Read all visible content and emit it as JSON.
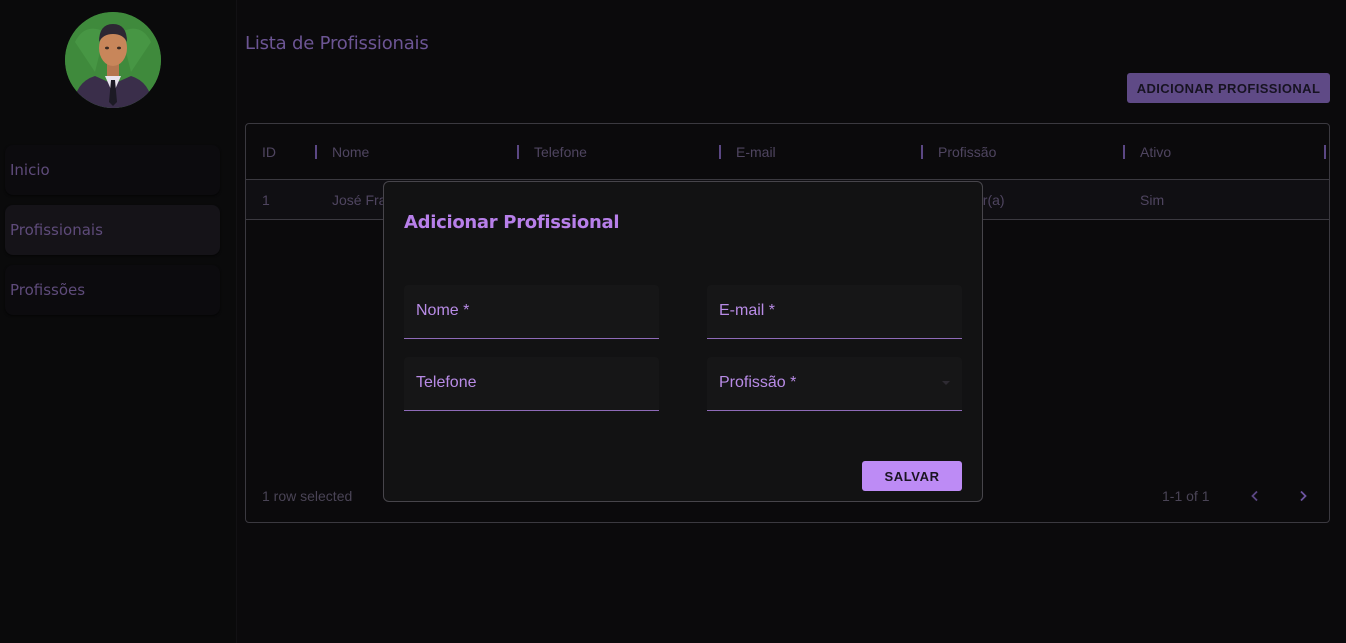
{
  "sidebar": {
    "items": [
      {
        "label": "Inicio"
      },
      {
        "label": "Profissionais"
      },
      {
        "label": "Profissões"
      }
    ]
  },
  "main": {
    "title": "Lista de Profissionais",
    "add_button": "ADICIONAR PROFISSIONAL"
  },
  "grid": {
    "columns": [
      "ID",
      "Nome",
      "Telefone",
      "E-mail",
      "Profissão",
      "Ativo"
    ],
    "rows": [
      {
        "id": "1",
        "nome": "José Fra",
        "profissao": "sor(a)",
        "ativo": "Sim"
      }
    ],
    "selection_text": "1 row selected",
    "pagination_text": "1-1 of 1"
  },
  "modal": {
    "title": "Adicionar Profissional",
    "fields": {
      "nome": "Nome *",
      "email": "E-mail *",
      "telefone": "Telefone",
      "profissao": "Profissão *"
    },
    "save_button": "SALVAR"
  },
  "colors": {
    "accent": "#bd8bf5",
    "accent_muted": "#5f4a86",
    "background": "#0b0a0c"
  }
}
